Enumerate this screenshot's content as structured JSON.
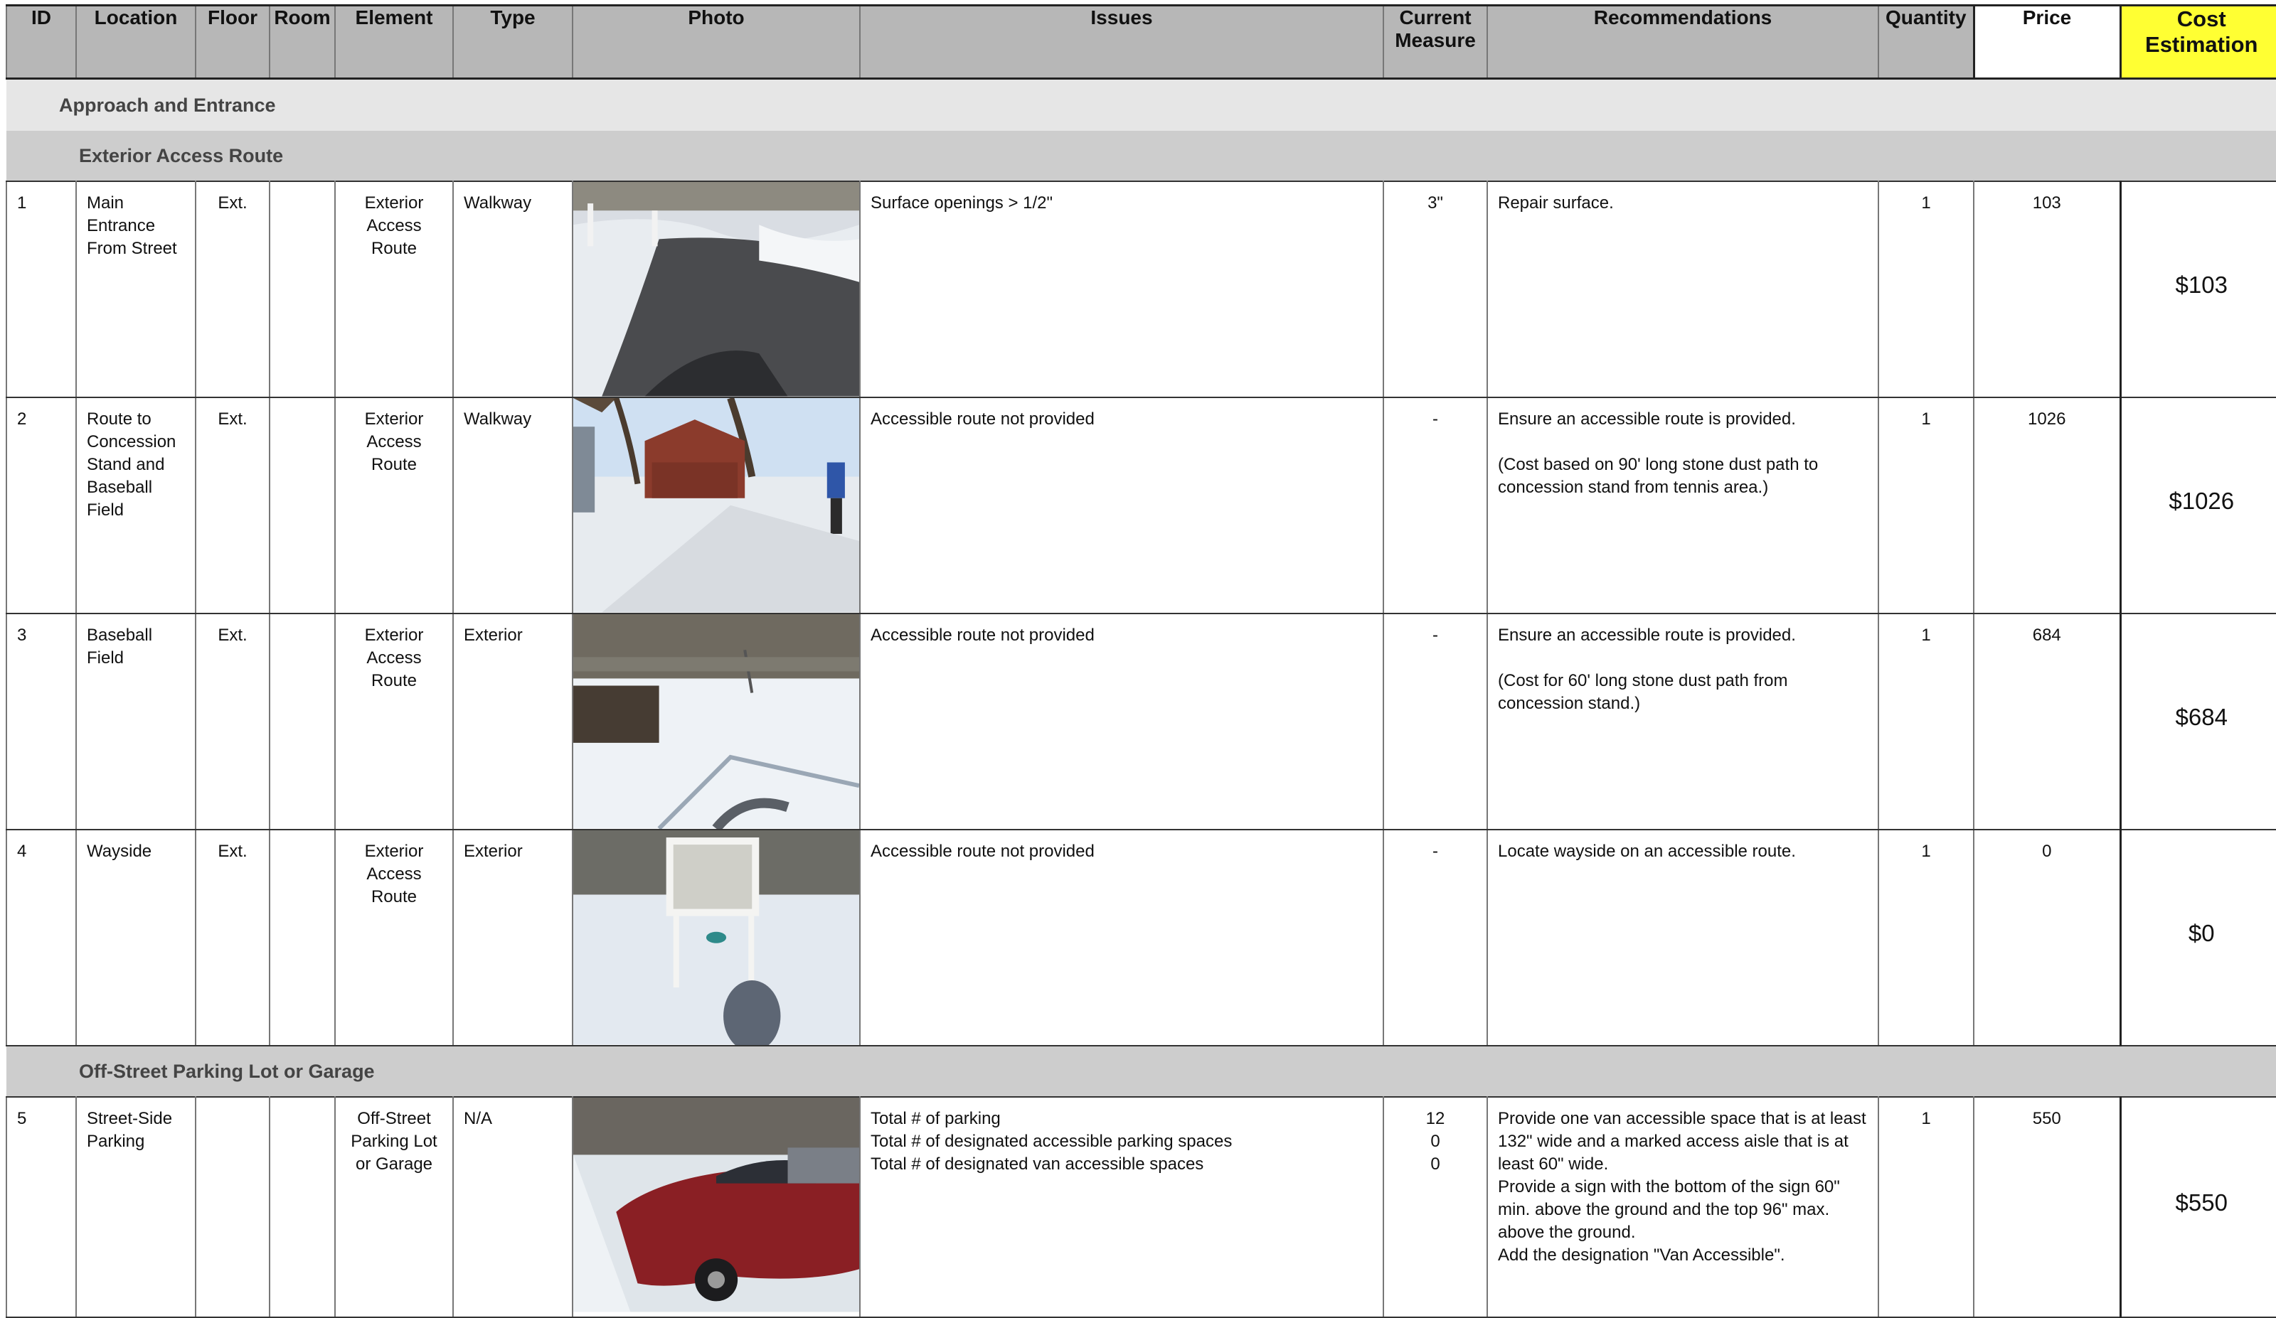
{
  "headers": {
    "id": "ID",
    "location": "Location",
    "floor": "Floor",
    "room": "Room",
    "element": "Element",
    "type": "Type",
    "photo": "Photo",
    "issues": "Issues",
    "current_measure": "Current\nMeasure",
    "recommendations": "Recommendations",
    "quantity": "Quantity",
    "price": "Price",
    "cost_estimation": "Cost\nEstimation"
  },
  "section": {
    "title": "Approach and Entrance"
  },
  "subsections": {
    "exterior": "Exterior Access Route",
    "parking": "Off-Street Parking Lot or Garage"
  },
  "colors": {
    "header_bg": "#b7b7b7",
    "cost_header_bg": "#ffff33",
    "section_bg": "#e6e6e6",
    "subsection_bg": "#cdcdcd"
  },
  "rows": [
    {
      "id": "1",
      "location": "Main\nEntrance\nFrom Street",
      "floor": "Ext.",
      "room": "",
      "element": "Exterior\nAccess\nRoute",
      "type": "Walkway",
      "photo_icon": "photo-snowy-asphalt-entrance",
      "issues": "Surface openings > 1/2\"",
      "current_measure": "3\"",
      "recommendations": "Repair surface.",
      "quantity": "1",
      "price": "103",
      "cost": "$103"
    },
    {
      "id": "2",
      "location": "Route to\nConcession\nStand and\nBaseball\nField",
      "floor": "Ext.",
      "room": "",
      "element": "Exterior\nAccess\nRoute",
      "type": "Walkway",
      "photo_icon": "photo-concession-stand",
      "issues": "Accessible route not provided",
      "current_measure": "-",
      "recommendations": "Ensure an accessible route is provided.\n\n(Cost based on 90' long stone dust path to\nconcession stand from tennis area.)",
      "quantity": "1",
      "price": "1026",
      "cost": "$1026"
    },
    {
      "id": "3",
      "location": "Baseball\nField",
      "floor": "Ext.",
      "room": "",
      "element": "Exterior\nAccess\nRoute",
      "type": "Exterior",
      "photo_icon": "photo-snowy-baseball-field",
      "issues": "Accessible route not provided",
      "current_measure": "-",
      "recommendations": "Ensure an accessible route is provided.\n\n(Cost for 60' long stone dust path from\nconcession stand.)",
      "quantity": "1",
      "price": "684",
      "cost": "$684"
    },
    {
      "id": "4",
      "location": "Wayside",
      "floor": "Ext.",
      "room": "",
      "element": "Exterior\nAccess\nRoute",
      "type": "Exterior",
      "photo_icon": "photo-wayside-sign",
      "issues": "Accessible route not provided",
      "current_measure": "-",
      "recommendations": "Locate wayside on an accessible route.",
      "quantity": "1",
      "price": "0",
      "cost": "$0"
    },
    {
      "id": "5",
      "location": "Street-Side\nParking",
      "floor": "",
      "room": "",
      "element": "Off-Street\nParking Lot\nor Garage",
      "type": "N/A",
      "photo_icon": "photo-street-parking-car",
      "issues": "Total # of parking\nTotal # of designated accessible parking spaces\nTotal # of designated van accessible spaces",
      "current_measure": "12\n0\n0",
      "recommendations": "Provide one van accessible space that is at least\n132\" wide and a marked access aisle that is at\nleast 60\" wide.\nProvide a sign with the bottom of the sign 60\"\nmin. above the ground and the top 96\" max.\nabove the ground.\nAdd the designation \"Van Accessible\".",
      "quantity": "1",
      "price": "550",
      "cost": "$550"
    }
  ]
}
